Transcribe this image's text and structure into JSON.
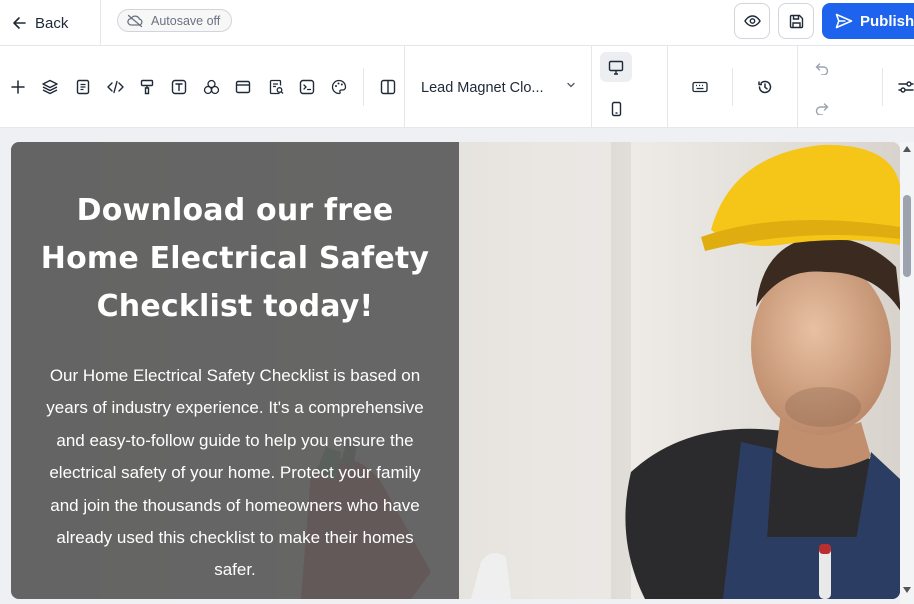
{
  "header": {
    "back_label": "Back",
    "autosave_label": "Autosave off",
    "publish_label": "Publish"
  },
  "toolbar": {
    "page_selector_value": "Lead Magnet Clo..."
  },
  "canvas": {
    "headline": "Download our free Home Electrical Safety Checklist today!",
    "body": "Our Home Electrical Safety Checklist is based on years of industry experience. It's a comprehensive and easy-to-follow guide to help you ensure the electrical safety of your home. Protect your family and join the thousands of homeowners who have already used this checklist to make their homes safer."
  },
  "colors": {
    "publish": "#1d63ed",
    "overlay": "#5c5c5c",
    "hard_hat": "#f5c518"
  },
  "icons": [
    "arrow-left-icon",
    "cloud-off-icon",
    "eye-icon",
    "save-icon",
    "send-icon",
    "plus-icon",
    "layers-icon",
    "page-icon",
    "code-icon",
    "paint-roller-icon",
    "text-icon",
    "shapes-icon",
    "layout-icon",
    "form-icon",
    "terminal-icon",
    "palette-icon",
    "columns-icon",
    "chevron-down-icon",
    "desktop-icon",
    "mobile-icon",
    "keyboard-icon",
    "history-icon",
    "undo-icon",
    "redo-icon",
    "settings-sliders-icon"
  ]
}
